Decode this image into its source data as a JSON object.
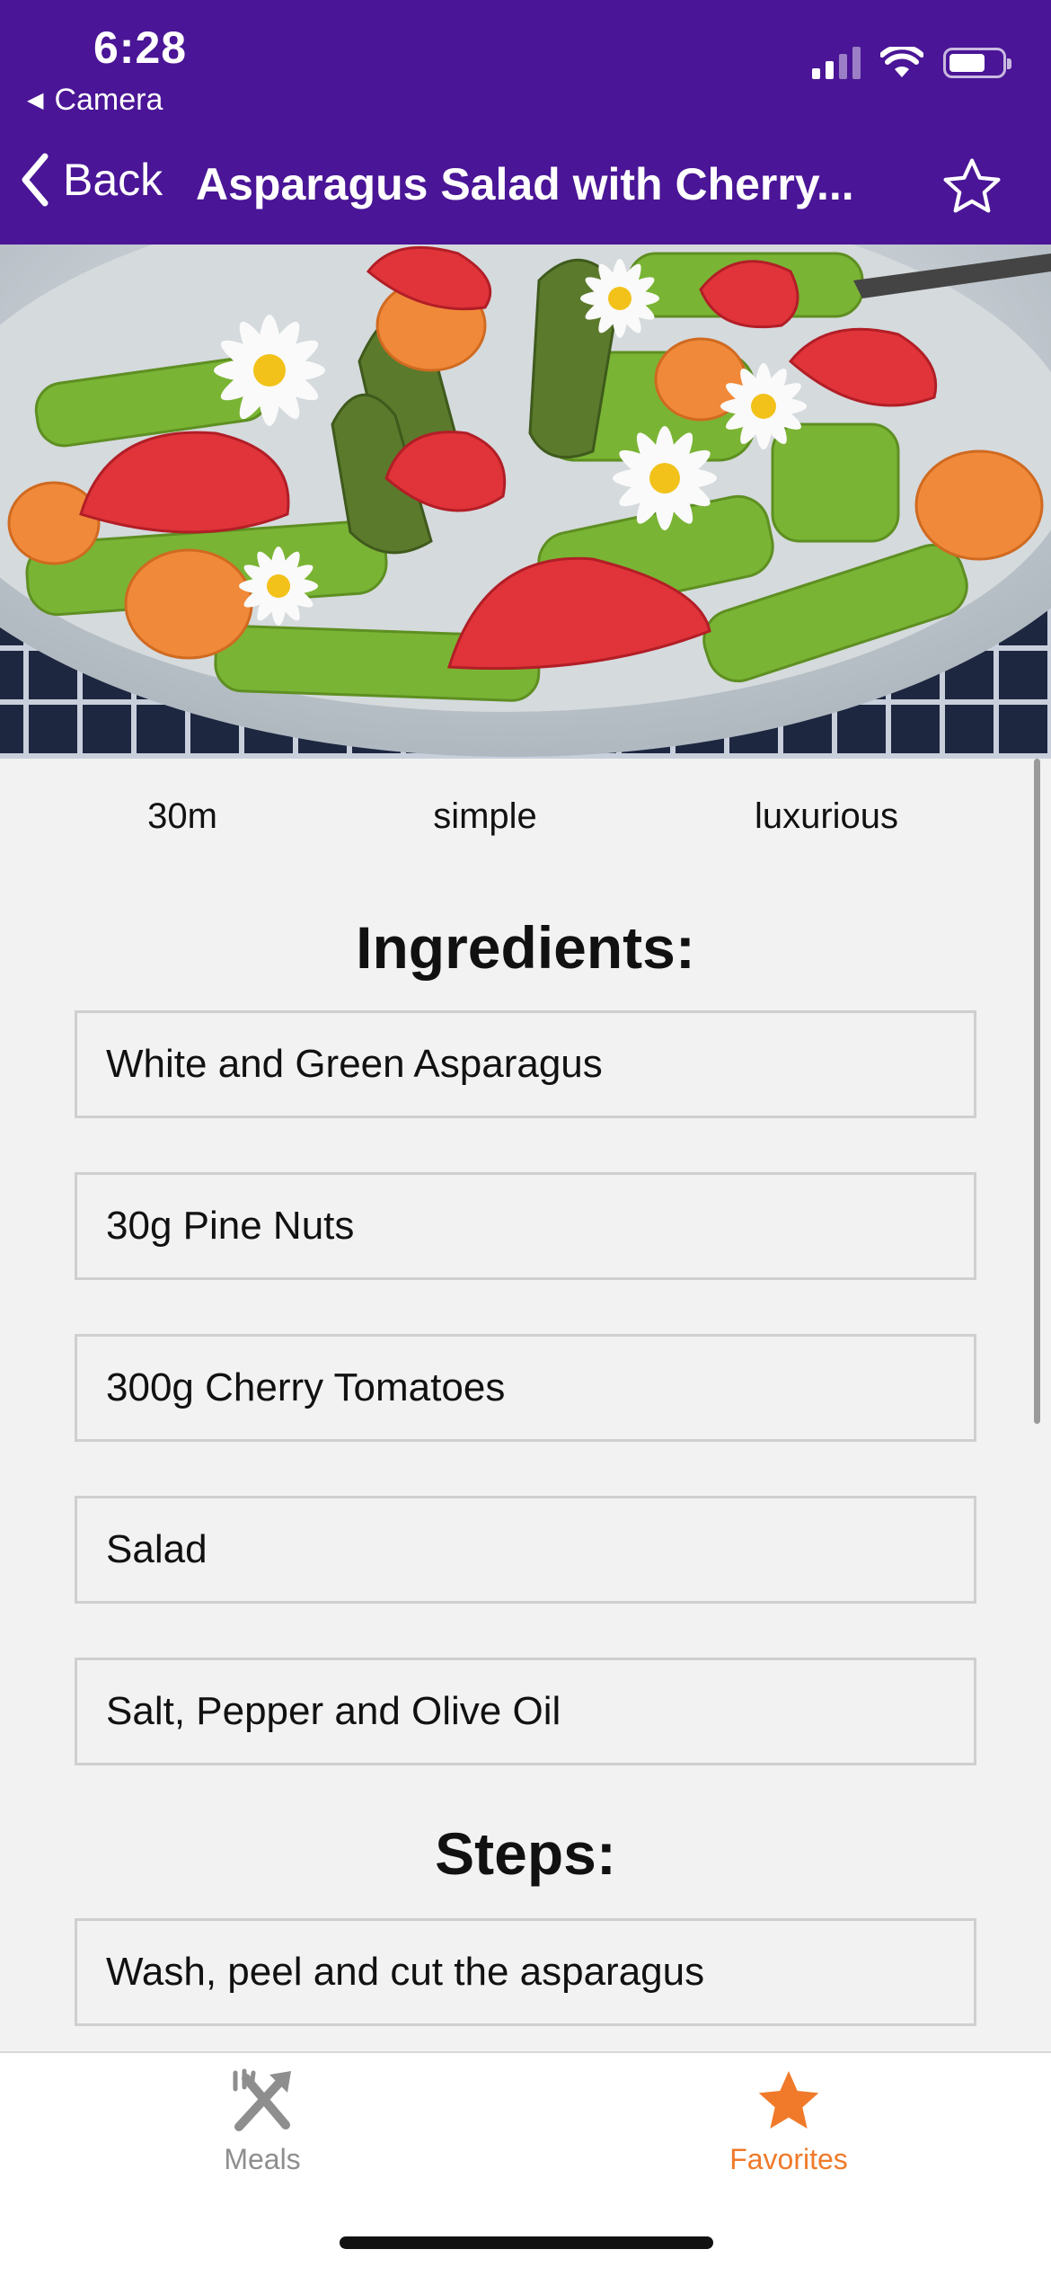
{
  "status_bar": {
    "time": "6:28",
    "back_app_label": "Camera"
  },
  "nav": {
    "back_label": "Back",
    "title": "Asparagus Salad with Cherry...",
    "favorite_icon": "star-outline-icon"
  },
  "hero": {
    "icon": "asparagus-salad-photo"
  },
  "meal_info": {
    "duration": "30m",
    "complexity": "simple",
    "affordability": "luxurious"
  },
  "ingredients": {
    "title": "Ingredients:",
    "items": [
      "White and Green Asparagus",
      "30g Pine Nuts",
      "300g Cherry Tomatoes",
      "Salad",
      "Salt, Pepper and Olive Oil"
    ]
  },
  "steps": {
    "title": "Steps:",
    "items": [
      "Wash, peel and cut the asparagus"
    ]
  },
  "tabbar": {
    "tabs": [
      {
        "label": "Meals",
        "icon": "fork-knife-icon",
        "active": false
      },
      {
        "label": "Favorites",
        "icon": "star-icon",
        "active": true
      }
    ]
  },
  "colors": {
    "header": "#4a1596",
    "active_tab": "#f07a2a",
    "inactive_tab": "#8e8e8e",
    "background": "#f2f2f2"
  }
}
